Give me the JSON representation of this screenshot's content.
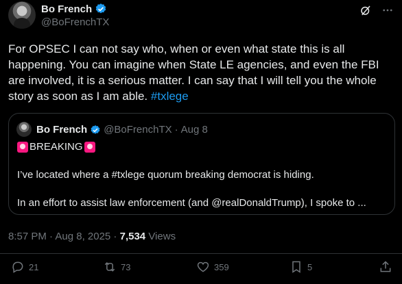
{
  "author": {
    "name": "Bo French",
    "handle": "@BoFrenchTX"
  },
  "tweet": {
    "text": "For OPSEC I can not say who, when or even what state this is all happening. You can imagine when State LE agencies, and even the FBI are involved, it is a serious matter.  I can say that I will tell you the whole story as soon as I am able. ",
    "hashtag": "#txlege"
  },
  "quote": {
    "name": "Bo French",
    "handle": "@BoFrenchTX",
    "separator": "·",
    "date": "Aug 8",
    "line1": "BREAKING",
    "line2": "I’ve located where a #txlege quorum breaking democrat is hiding.",
    "line3": "In an effort to assist law enforcement (and @realDonaldTrump), I spoke to ..."
  },
  "meta": {
    "time": "8:57 PM · Aug 8, 2025 · ",
    "views_count": "7,534",
    "views_label": " Views"
  },
  "actions": {
    "replies": "21",
    "reposts": "73",
    "likes": "359",
    "bookmarks": "5"
  },
  "icons": [
    "verified-badge-icon",
    "grok-icon",
    "more-icon",
    "siren-icon",
    "reply-icon",
    "repost-icon",
    "like-icon",
    "bookmark-icon",
    "share-icon"
  ],
  "colors": {
    "accent": "#1d9bf0",
    "muted": "#71767b",
    "text": "#e7e9ea",
    "border": "#2f3336"
  }
}
